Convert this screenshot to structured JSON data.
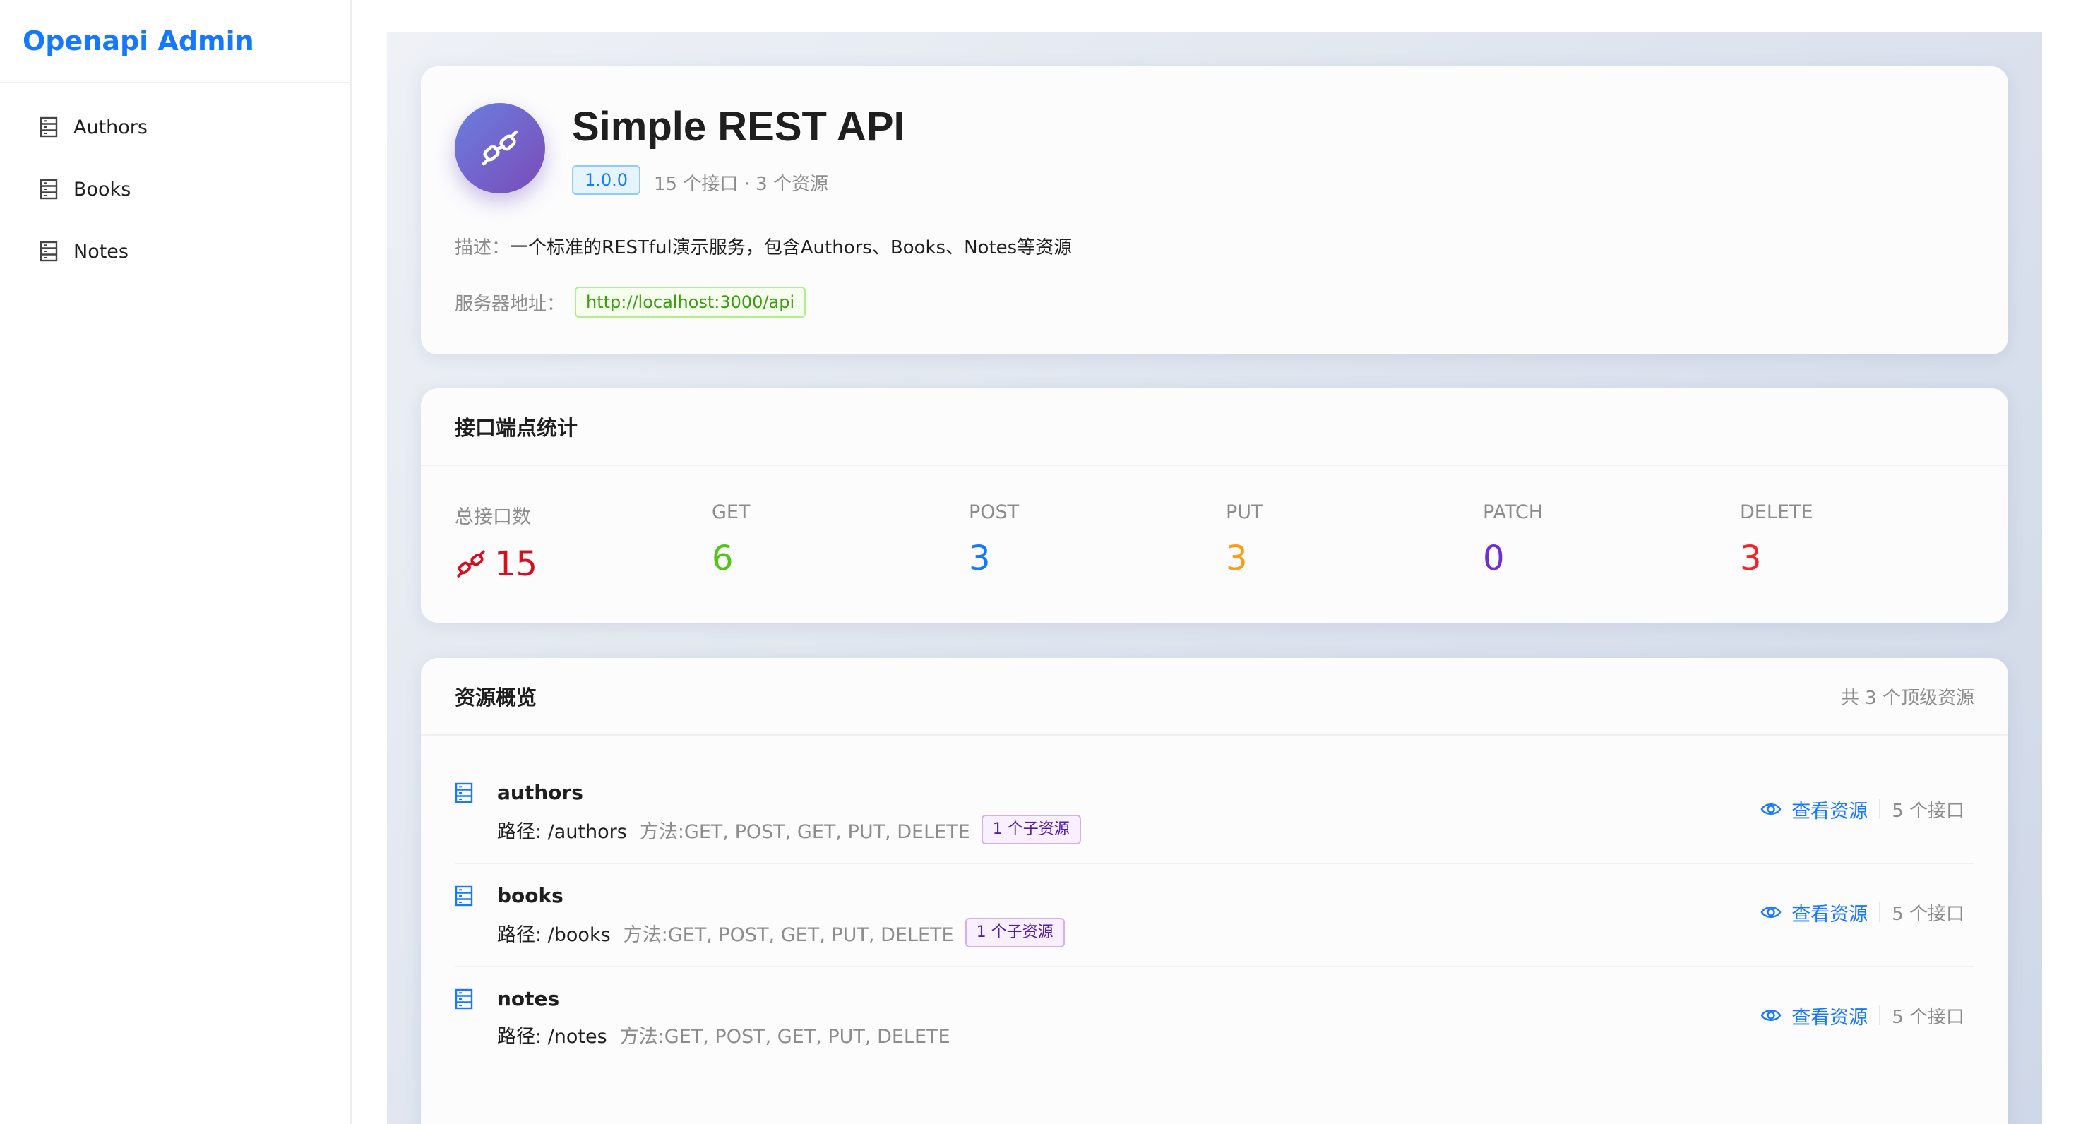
{
  "app": {
    "title": "Openapi Admin"
  },
  "sidebar": {
    "items": [
      {
        "label": "Authors",
        "icon": "database-icon"
      },
      {
        "label": "Books",
        "icon": "database-icon"
      },
      {
        "label": "Notes",
        "icon": "database-icon"
      }
    ]
  },
  "api_info": {
    "title": "Simple REST API",
    "version": "1.0.0",
    "meta": "15 个接口 · 3 个资源",
    "description_label": "描述：",
    "description": "一个标准的RESTful演示服务，包含Authors、Books、Notes等资源",
    "server_label": "服务器地址：",
    "server_url": "http://localhost:3000/api",
    "icon": "api-plug-icon"
  },
  "stats": {
    "title": "接口端点统计",
    "items": [
      {
        "label": "总接口数",
        "value": "15",
        "color": "#cf1322",
        "icon": "api-plug-icon"
      },
      {
        "label": "GET",
        "value": "6",
        "color": "#52c41a"
      },
      {
        "label": "POST",
        "value": "3",
        "color": "#1677ff"
      },
      {
        "label": "PUT",
        "value": "3",
        "color": "#fa9d14"
      },
      {
        "label": "PATCH",
        "value": "0",
        "color": "#722ed1"
      },
      {
        "label": "DELETE",
        "value": "3",
        "color": "#f5222d"
      }
    ]
  },
  "resources": {
    "title": "资源概览",
    "extra": "共 3 个顶级资源",
    "view_label": "查看资源",
    "items": [
      {
        "name": "authors",
        "path": "路径: /authors",
        "methods": "方法:GET, POST, GET, PUT, DELETE",
        "sub": "1 个子资源",
        "count": "5 个接口"
      },
      {
        "name": "books",
        "path": "路径: /books",
        "methods": "方法:GET, POST, GET, PUT, DELETE",
        "sub": "1 个子资源",
        "count": "5 个接口"
      },
      {
        "name": "notes",
        "path": "路径: /notes",
        "methods": "方法:GET, POST, GET, PUT, DELETE",
        "sub": "",
        "count": "5 个接口"
      }
    ]
  }
}
